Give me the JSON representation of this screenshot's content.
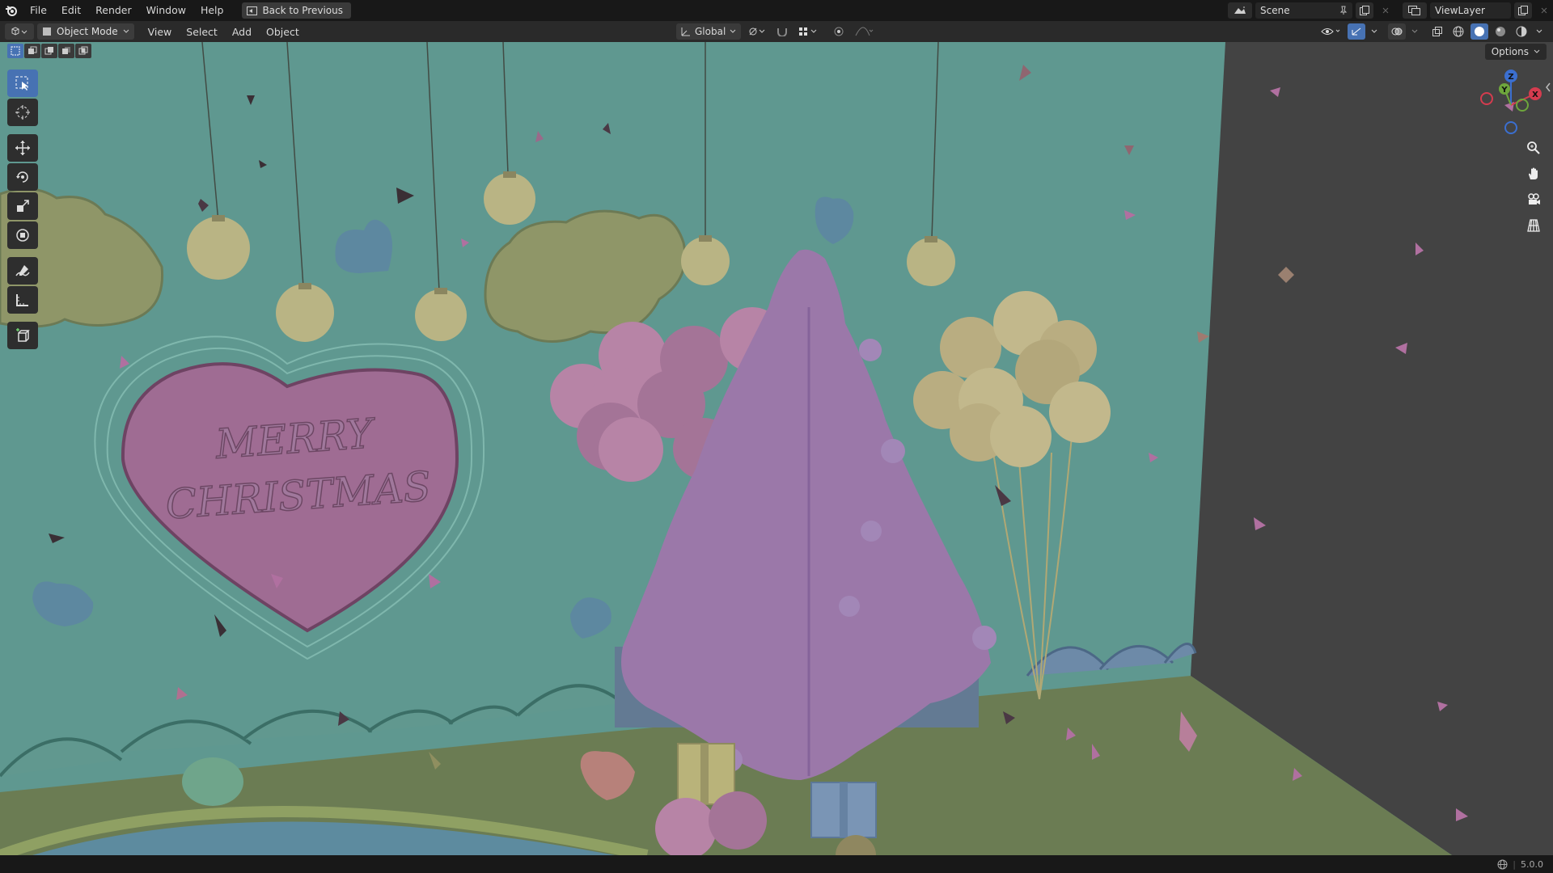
{
  "menu": {
    "items": [
      "File",
      "Edit",
      "Render",
      "Window",
      "Help"
    ],
    "back_label": "Back to Previous"
  },
  "topbar_right": {
    "scene_label": "Scene",
    "viewlayer_label": "ViewLayer"
  },
  "header": {
    "mode_label": "Object Mode",
    "menus": [
      "View",
      "Select",
      "Add",
      "Object"
    ],
    "transform_orientation": "Global",
    "options_label": "Options"
  },
  "scene": {
    "sign_line1": "MERRY",
    "sign_line2": "CHRISTMAS"
  },
  "gizmo": {
    "z": "Z",
    "y": "Y",
    "x": "X"
  },
  "status": {
    "version": "5.0.0"
  },
  "colors": {
    "accent": "#4772b3",
    "wall": "#5f9890",
    "floor": "#6b7c53",
    "tree": "#9b78a9",
    "ornament_gold": "#c2bc8c",
    "balloon_pink": "#b784a6"
  }
}
